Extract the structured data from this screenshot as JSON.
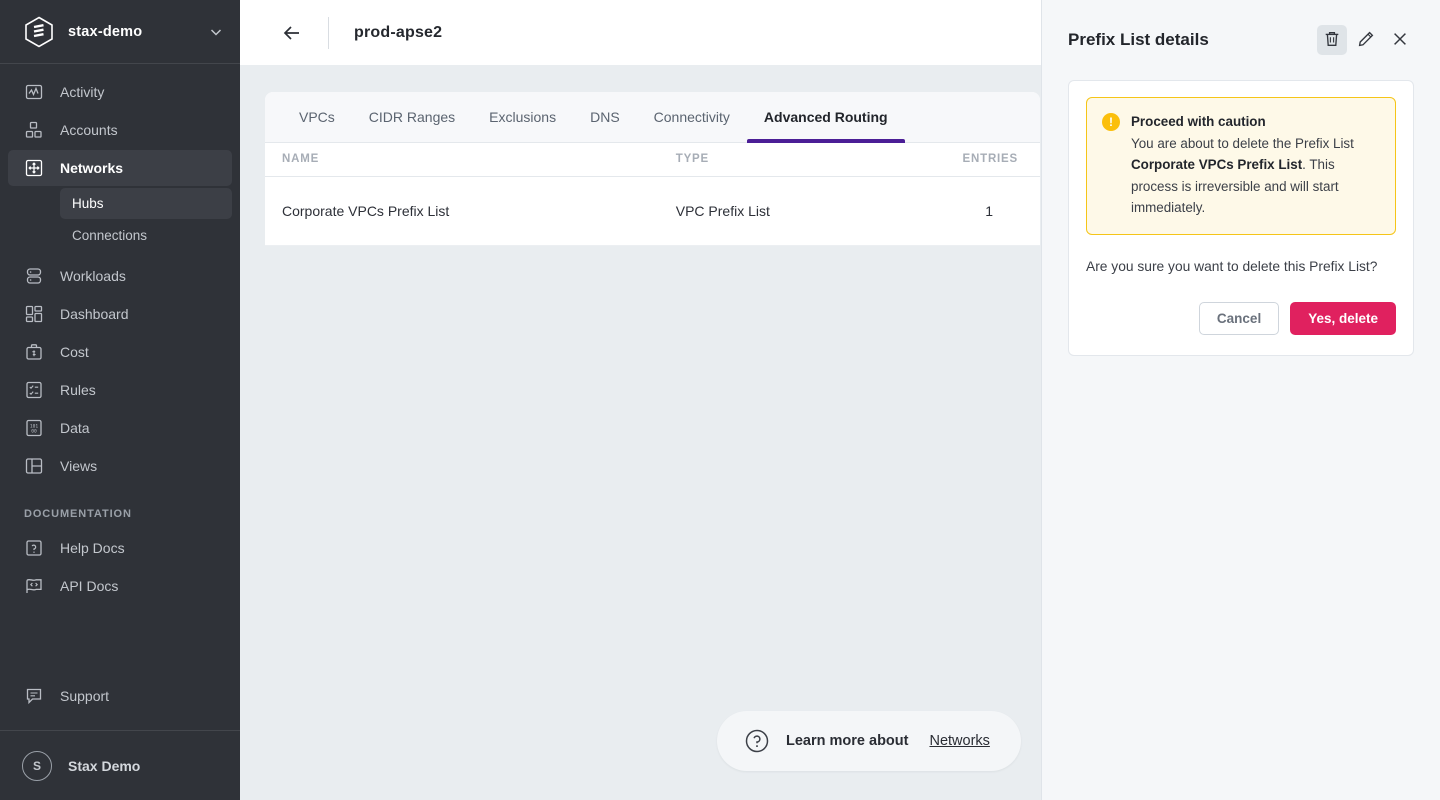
{
  "sidebar": {
    "org": {
      "name": "stax-demo",
      "logo_icon": "stax-logo-icon",
      "chevron_icon": "chevron-down-icon"
    },
    "items": [
      {
        "label": "Activity",
        "icon": "activity-icon",
        "active": false
      },
      {
        "label": "Accounts",
        "icon": "accounts-icon",
        "active": false
      },
      {
        "label": "Networks",
        "icon": "networks-icon",
        "active": true
      },
      {
        "label": "Workloads",
        "icon": "workloads-icon",
        "active": false
      },
      {
        "label": "Dashboard",
        "icon": "dashboard-icon",
        "active": false
      },
      {
        "label": "Cost",
        "icon": "cost-icon",
        "active": false
      },
      {
        "label": "Rules",
        "icon": "rules-icon",
        "active": false
      },
      {
        "label": "Data",
        "icon": "data-icon",
        "active": false
      },
      {
        "label": "Views",
        "icon": "views-icon",
        "active": false
      }
    ],
    "sub_items": [
      {
        "label": "Hubs",
        "active": true
      },
      {
        "label": "Connections",
        "active": false
      }
    ],
    "section_label": "DOCUMENTATION",
    "docs_items": [
      {
        "label": "Help Docs",
        "icon": "help-docs-icon"
      },
      {
        "label": "API Docs",
        "icon": "api-docs-icon"
      }
    ],
    "support": {
      "label": "Support",
      "icon": "support-icon"
    },
    "user": {
      "name": "Stax Demo",
      "initial": "S"
    }
  },
  "topbar": {
    "back_icon": "arrow-left-icon",
    "title": "prod-apse2"
  },
  "tabs": [
    {
      "label": "VPCs",
      "active": false
    },
    {
      "label": "CIDR Ranges",
      "active": false
    },
    {
      "label": "Exclusions",
      "active": false
    },
    {
      "label": "DNS",
      "active": false
    },
    {
      "label": "Connectivity",
      "active": false
    },
    {
      "label": "Advanced Routing",
      "active": true
    }
  ],
  "table": {
    "columns": [
      "NAME",
      "TYPE",
      "ENTRIES"
    ],
    "rows": [
      {
        "name": "Corporate VPCs Prefix List",
        "type": "VPC Prefix List",
        "entries": "1"
      }
    ]
  },
  "learn_more": {
    "icon": "question-circle-icon",
    "text": "Learn more about",
    "link": "Networks"
  },
  "panel": {
    "title": "Prefix List details",
    "actions": [
      {
        "name": "delete",
        "icon": "trash-icon",
        "active": true
      },
      {
        "name": "edit",
        "icon": "pencil-icon",
        "active": false
      },
      {
        "name": "close",
        "icon": "close-icon",
        "active": false
      }
    ],
    "alert": {
      "icon": "exclamation-icon",
      "glyph": "!",
      "title": "Proceed with caution",
      "body_before": "You are about to delete the Prefix List ",
      "body_bold": "Corporate VPCs Prefix List",
      "body_after": ". This process is irreversible and will start immediately."
    },
    "confirm_text": "Are you sure you want to delete this Prefix List?",
    "cancel_label": "Cancel",
    "delete_label": "Yes, delete"
  },
  "colors": {
    "accent_purple": "#4b1e96",
    "danger": "#e0215f",
    "warning": "#fbbf0c",
    "sidebar_bg": "#2f3238",
    "content_bg": "#e9edf0",
    "panel_bg": "#f5f7f9"
  }
}
